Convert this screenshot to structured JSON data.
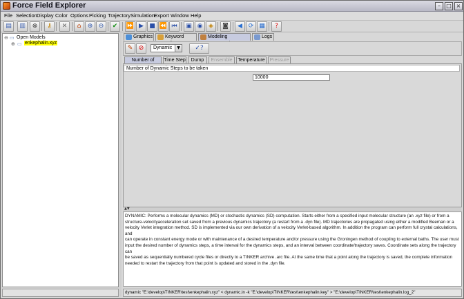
{
  "window": {
    "title": "Force Field Explorer"
  },
  "menu": [
    "File",
    "Selection",
    "Display",
    "Color",
    "Options",
    "Picking",
    "Trajectory",
    "Simulation",
    "Export",
    "Window",
    "Help"
  ],
  "tree": {
    "root": "Open Models",
    "child": "enkephalin.xyz"
  },
  "tabs": [
    "Graphics",
    "Keyword Editor",
    "Modeling Commands",
    "Logs"
  ],
  "command": {
    "selected": "Dynamic"
  },
  "subtabs": [
    "Number of Steps",
    "Time Step",
    "Dump",
    "Ensemble",
    "Temperature",
    "Pressure"
  ],
  "parameter": {
    "description": "Number of Dynamic Steps to be taken",
    "value": "10000"
  },
  "help": {
    "lines": [
      "DYNAMIC: Performs a molecular dynamics (MD) or stochastic dynamics (SD) computation. Starts either  from a specified input molecular structure (an .xyz file) or from a",
      "structure-velocityacceleration  set saved from a previous dynamics trajectory (a restart from a .dyn file). MD  trajectories are propagated using either a modified Beeman or a",
      "velocity Verlet integration  method. SD is implemented via our own derivation of a velocity Verlet-based algorithm. In  addition the program can perform full crystal calculations, and",
      "can operate in constant  energy mode or with maintenance of a desired temperature and/or pressure using the  Groningen method of coupling to external baths. The user must",
      "input the desired number of  dynamics steps, a time interval for the dynamics steps, and an interval between  coordinate/trajectory saves. Coordinate sets along the trajectory can",
      "be saved as sequentially  numbered cycle files or directly to a TINKER archive .arc file. At the same time that a point  along the trajectory is saved, the complete information",
      "needed to restart the trajectory from  that point is updated and stored in the .dyn file."
    ]
  },
  "status": {
    "command_line": "dynamic \"E:\\develop\\TINKER\\test\\enkephalin.xyz\"  < dynamic.in  -k \"E:\\develop\\TINKER\\test\\enkephalin.key\" > \"E:\\develop\\TINKER\\test\\enkephalin.log_2\""
  },
  "colors": {
    "tab_active": "#c7cbe0",
    "tree_highlight": "#ffff00"
  }
}
